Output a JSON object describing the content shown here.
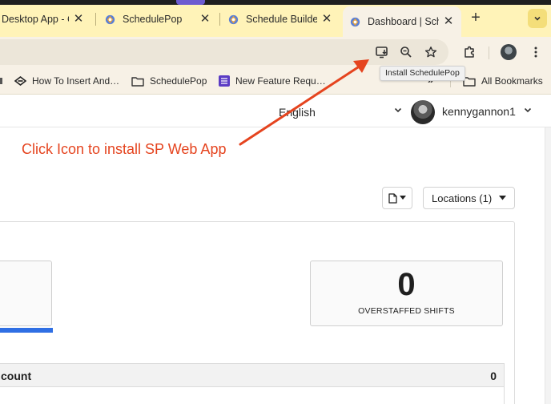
{
  "browser": {
    "tabs": [
      {
        "title": "Desktop App - C",
        "close": "✕",
        "active": false
      },
      {
        "title": "SchedulePop",
        "close": "✕",
        "active": false
      },
      {
        "title": "Schedule Builde",
        "close": "✕",
        "active": false
      },
      {
        "title": "Dashboard | Sch",
        "close": "✕",
        "active": true
      }
    ],
    "new_tab": "+",
    "install_tooltip": "Install SchedulePop",
    "bookmarks": [
      {
        "label": "How To Insert And…",
        "icon": "codepen-icon"
      },
      {
        "label": "SchedulePop",
        "icon": "folder-icon"
      },
      {
        "label": "New Feature Requ…",
        "icon": "form-icon"
      }
    ],
    "bookmarks_overflow": "»",
    "all_bookmarks": "All Bookmarks"
  },
  "page": {
    "language": "English",
    "username": "kennygannon1",
    "annotation": "Click Icon to install SP Web App",
    "locations_button": "Locations (1)",
    "stats": [
      {
        "value": "",
        "label": ""
      },
      {
        "value": "0",
        "label": "OVERSTAFFED SHIFTS"
      }
    ],
    "count_row": {
      "label": "count",
      "value": "0"
    }
  },
  "colors": {
    "annotation": "#e5441f",
    "tab_strip": "#fff3b8",
    "toolbar": "#f7f1e6",
    "progress": "#2f6fe4"
  }
}
